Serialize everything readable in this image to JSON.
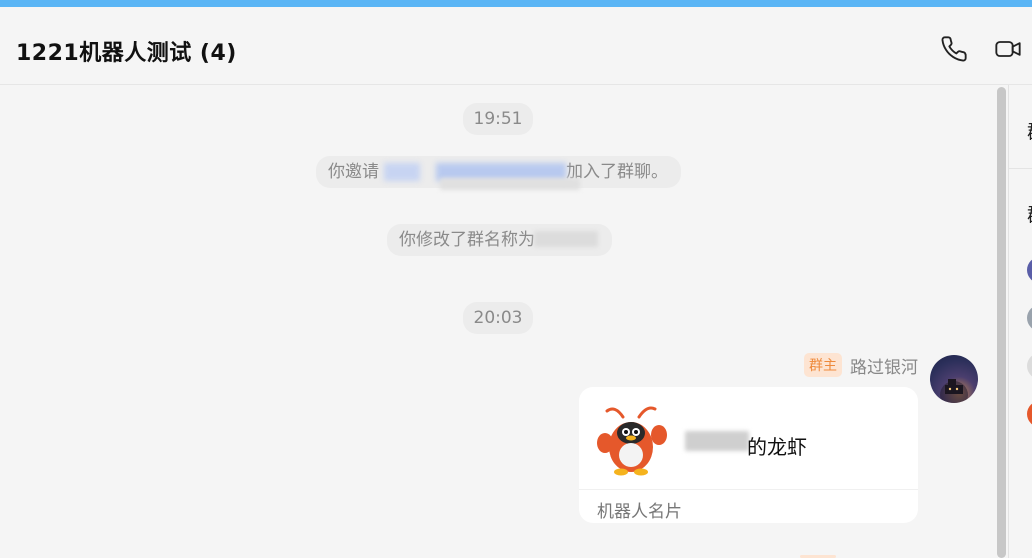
{
  "header": {
    "title": "1221机器人测试 (4)",
    "icons": [
      "phone-icon",
      "video-call-icon"
    ]
  },
  "chat": {
    "time_1": "19:51",
    "system_invite": "你邀请",
    "system_invite_tail": "加入了群聊。",
    "system_rename": "你修改了群名称为",
    "time_2": "20:03",
    "message": {
      "badge": "群主",
      "sender": "路过银河",
      "card_name_suffix": "的龙虾",
      "card_footer": "机器人名片"
    }
  },
  "side_panel": {
    "heading_1": "群",
    "heading_2": "群"
  },
  "colors": {
    "accent_bar": "#5ab5f5",
    "badge_bg": "#fde4d2",
    "badge_text": "#ee8a3c"
  }
}
